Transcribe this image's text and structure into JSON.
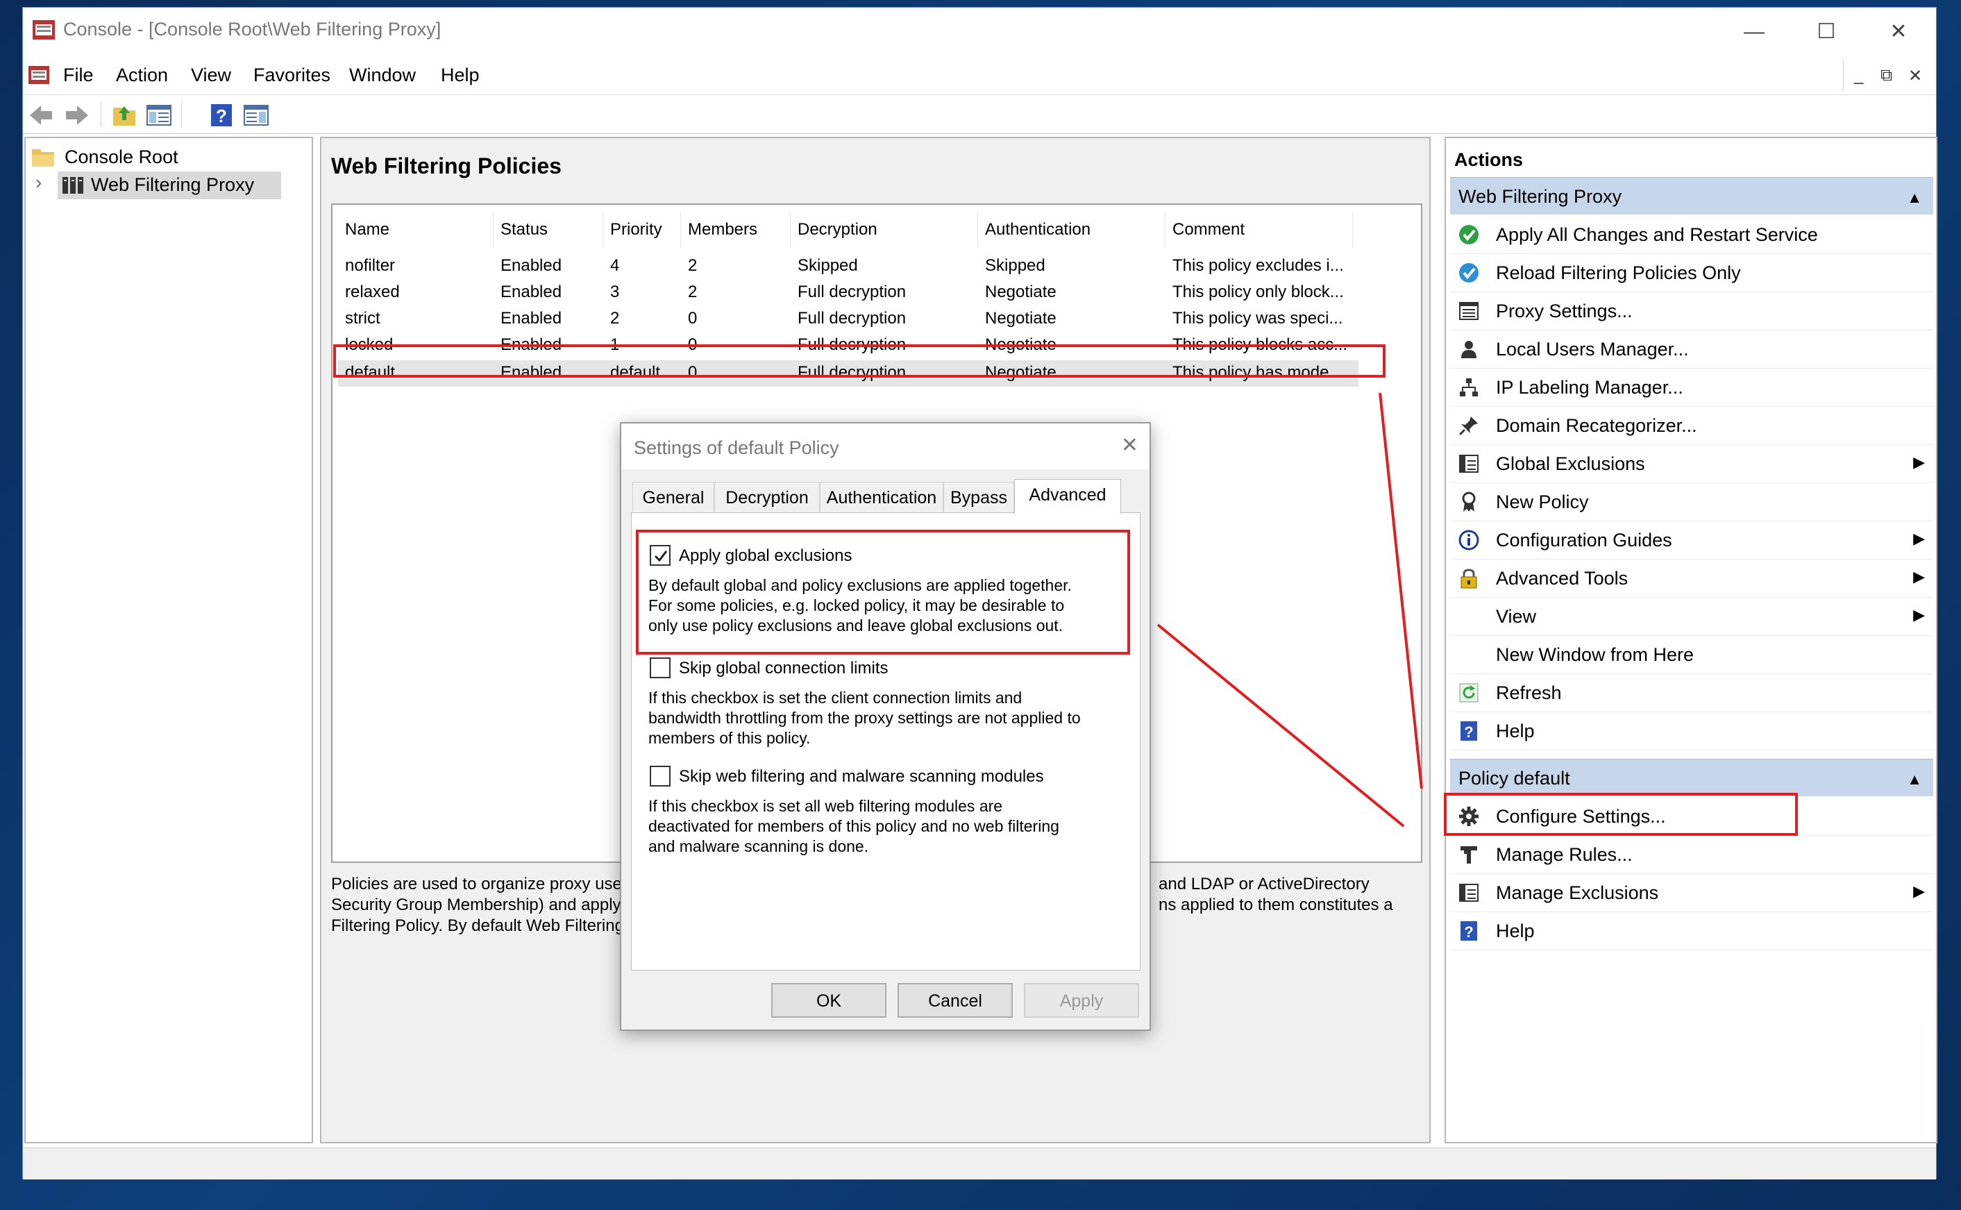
{
  "window": {
    "title": "Console - [Console Root\\Web Filtering Proxy]",
    "caption": {
      "minimize": "—",
      "maximize": "☐",
      "close": "✕"
    }
  },
  "menubar": {
    "items": [
      "File",
      "Action",
      "View",
      "Favorites",
      "Window",
      "Help"
    ],
    "mdi": {
      "minimize": "_",
      "restore": "⧉",
      "close": "✕"
    }
  },
  "tree": {
    "root": "Console Root",
    "child": "Web Filtering Proxy",
    "expander": "›"
  },
  "center": {
    "heading": "Web Filtering Policies",
    "columns": [
      "Name",
      "Status",
      "Priority",
      "Members",
      "Decryption",
      "Authentication",
      "Comment"
    ],
    "rows": [
      [
        "nofilter",
        "Enabled",
        "4",
        "2",
        "Skipped",
        "Skipped",
        "This policy excludes i..."
      ],
      [
        "relaxed",
        "Enabled",
        "3",
        "2",
        "Full decryption",
        "Negotiate",
        "This policy only block..."
      ],
      [
        "strict",
        "Enabled",
        "2",
        "0",
        "Full decryption",
        "Negotiate",
        "This policy was speci..."
      ],
      [
        "locked",
        "Enabled",
        "1",
        "0",
        "Full decryption",
        "Negotiate",
        "This policy blocks acc..."
      ],
      [
        "default",
        "Enabled",
        "default",
        "0",
        "Full decryption",
        "Negotiate",
        "This policy has mode..."
      ]
    ],
    "selected_row": 4,
    "description_left": [
      "Policies are used to organize proxy user",
      "Security Group Membership) and apply c",
      "Filtering Policy. By default Web Filtering"
    ],
    "description_right": [
      "and LDAP or ActiveDirectory",
      "ns applied to them constitutes a"
    ]
  },
  "actions": {
    "title": "Actions",
    "section1": {
      "header": "Web Filtering Proxy",
      "collapse_glyph": "▲",
      "items": [
        {
          "label": "Apply All Changes and Restart Service",
          "icon": "check-green-icon",
          "submenu": false
        },
        {
          "label": "Reload Filtering Policies Only",
          "icon": "check-blue-icon",
          "submenu": false
        },
        {
          "label": "Proxy Settings...",
          "icon": "settings-list-icon",
          "submenu": false
        },
        {
          "label": "Local Users Manager...",
          "icon": "user-icon",
          "submenu": false
        },
        {
          "label": "IP Labeling Manager...",
          "icon": "network-icon",
          "submenu": false
        },
        {
          "label": "Domain Recategorizer...",
          "icon": "pin-icon",
          "submenu": false
        },
        {
          "label": "Global Exclusions",
          "icon": "exclusions-list-icon",
          "submenu": true
        },
        {
          "label": "New Policy",
          "icon": "ribbon-icon",
          "submenu": false
        },
        {
          "label": "Configuration Guides",
          "icon": "info-icon",
          "submenu": true
        },
        {
          "label": "Advanced Tools",
          "icon": "padlock-icon",
          "submenu": true
        },
        {
          "label": "View",
          "icon": "",
          "submenu": true
        },
        {
          "label": "New Window from Here",
          "icon": "",
          "submenu": false
        },
        {
          "label": "Refresh",
          "icon": "refresh-icon",
          "submenu": false
        },
        {
          "label": "Help",
          "icon": "help-icon",
          "submenu": false
        }
      ]
    },
    "section2": {
      "header": "Policy default",
      "collapse_glyph": "▲",
      "items": [
        {
          "label": "Configure Settings...",
          "icon": "gear-icon",
          "submenu": false
        },
        {
          "label": "Manage Rules...",
          "icon": "rules-icon",
          "submenu": false
        },
        {
          "label": "Manage Exclusions",
          "icon": "exclusions-list-icon",
          "submenu": true
        },
        {
          "label": "Help",
          "icon": "help-icon",
          "submenu": false
        }
      ]
    },
    "submenu_glyph": "▶"
  },
  "dialog": {
    "title": "Settings of default Policy",
    "close": "✕",
    "tabs": [
      "General",
      "Decryption",
      "Authentication",
      "Bypass",
      "Advanced"
    ],
    "active_tab": "Advanced",
    "options": [
      {
        "label": "Apply global exclusions",
        "checked": true,
        "help": [
          "By default global and policy exclusions are applied together.",
          "For some policies, e.g. locked policy, it may be desirable to",
          "only use policy exclusions and leave global exclusions out."
        ]
      },
      {
        "label": "Skip global connection limits",
        "checked": false,
        "help": [
          "If this checkbox is set the client connection limits and",
          "bandwidth throttling from the proxy settings are not applied to",
          "members of this policy."
        ]
      },
      {
        "label": "Skip web filtering and malware scanning modules",
        "checked": false,
        "help": [
          "If this checkbox is set all web filtering modules are",
          "deactivated for members of this policy and no web filtering",
          "and malware scanning is done."
        ]
      }
    ],
    "buttons": {
      "ok": "OK",
      "cancel": "Cancel",
      "apply": "Apply"
    }
  },
  "colors": {
    "highlight": "#e02020",
    "section_header": "#c6d6eb",
    "desktop": "#0e3f7a"
  }
}
